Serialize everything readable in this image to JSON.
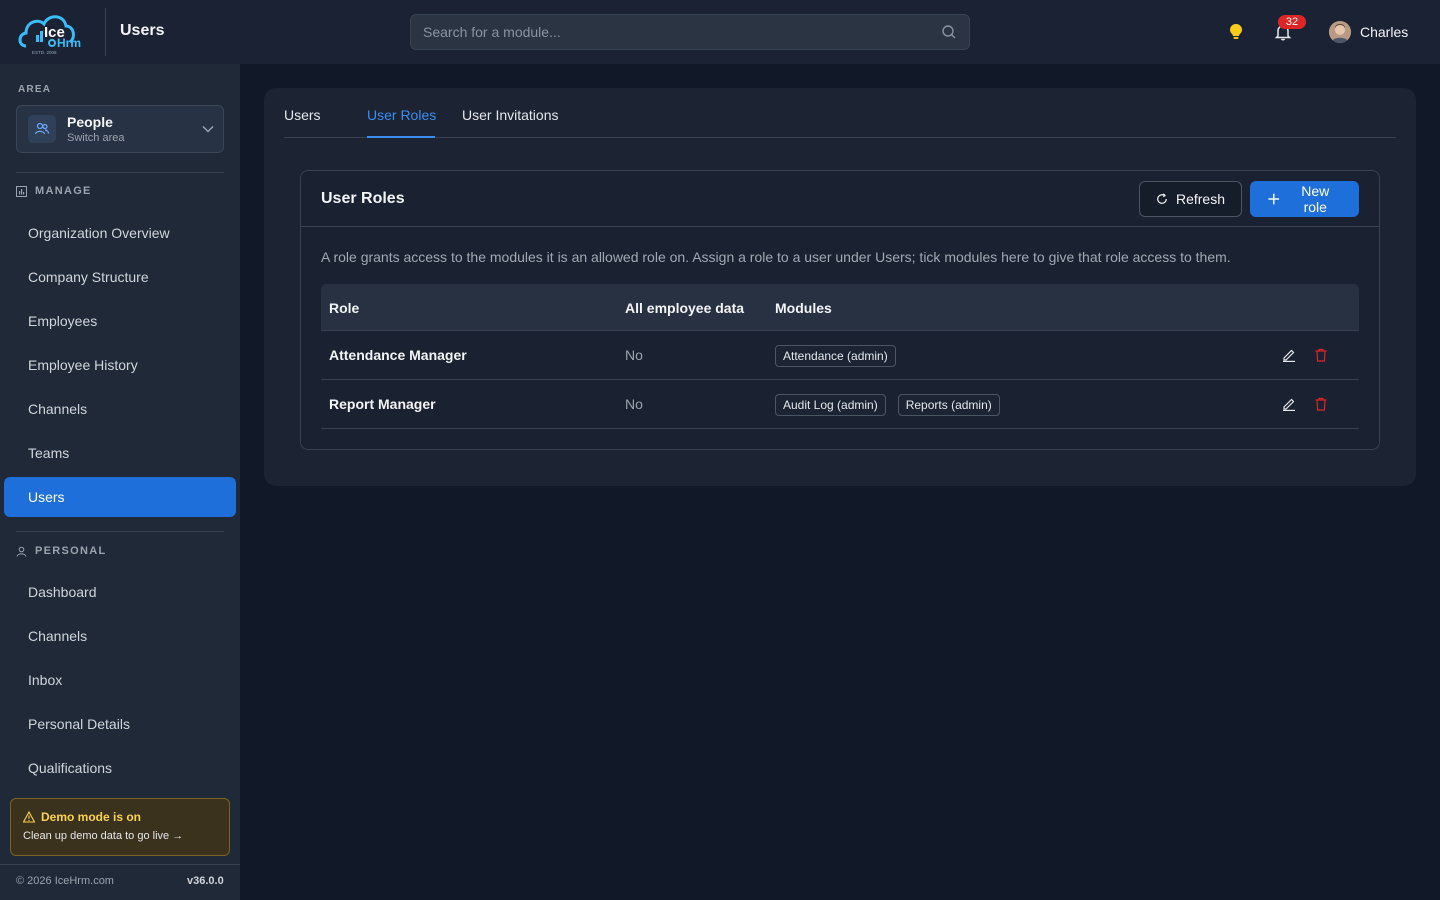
{
  "header": {
    "title": "Users",
    "search_placeholder": "Search for a module...",
    "notification_count": "32",
    "user_name": "Charles"
  },
  "logo": {
    "line1": "Ice",
    "line2": "Hrm",
    "tagline": "ESTD. 2008"
  },
  "sidebar": {
    "area_label": "AREA",
    "area_title": "People",
    "area_subtitle": "Switch area",
    "manage_label": "MANAGE",
    "manage_items": [
      {
        "label": "Organization Overview"
      },
      {
        "label": "Company Structure"
      },
      {
        "label": "Employees"
      },
      {
        "label": "Employee History"
      },
      {
        "label": "Channels"
      },
      {
        "label": "Teams"
      },
      {
        "label": "Users"
      }
    ],
    "personal_label": "PERSONAL",
    "personal_items": [
      {
        "label": "Dashboard"
      },
      {
        "label": "Channels"
      },
      {
        "label": "Inbox"
      },
      {
        "label": "Personal Details"
      },
      {
        "label": "Qualifications"
      }
    ],
    "demo_title": "Demo mode is on",
    "demo_link": "Clean up demo data to go live →",
    "copyright": "© 2026 IceHrm.com",
    "version": "v36.0.0"
  },
  "tabs": [
    {
      "label": "Users"
    },
    {
      "label": "User Roles"
    },
    {
      "label": "User Invitations"
    }
  ],
  "panel": {
    "title": "User Roles",
    "refresh_label": "Refresh",
    "new_label": "New role",
    "description": "A role grants access to the modules it is an allowed role on. Assign a role to a user under Users; tick modules here to give that role access to them."
  },
  "table": {
    "columns": [
      "Role",
      "All employee data",
      "Modules"
    ],
    "rows": [
      {
        "role": "Attendance Manager",
        "all_data": "No",
        "modules": [
          "Attendance (admin)"
        ]
      },
      {
        "role": "Report Manager",
        "all_data": "No",
        "modules": [
          "Audit Log (admin)",
          "Reports (admin)"
        ]
      }
    ]
  },
  "colors": {
    "accent": "#1e6fd9",
    "active_tab": "#3b8cf0",
    "danger": "#dc2626",
    "warning": "#fcd34d",
    "background": "#111827"
  }
}
